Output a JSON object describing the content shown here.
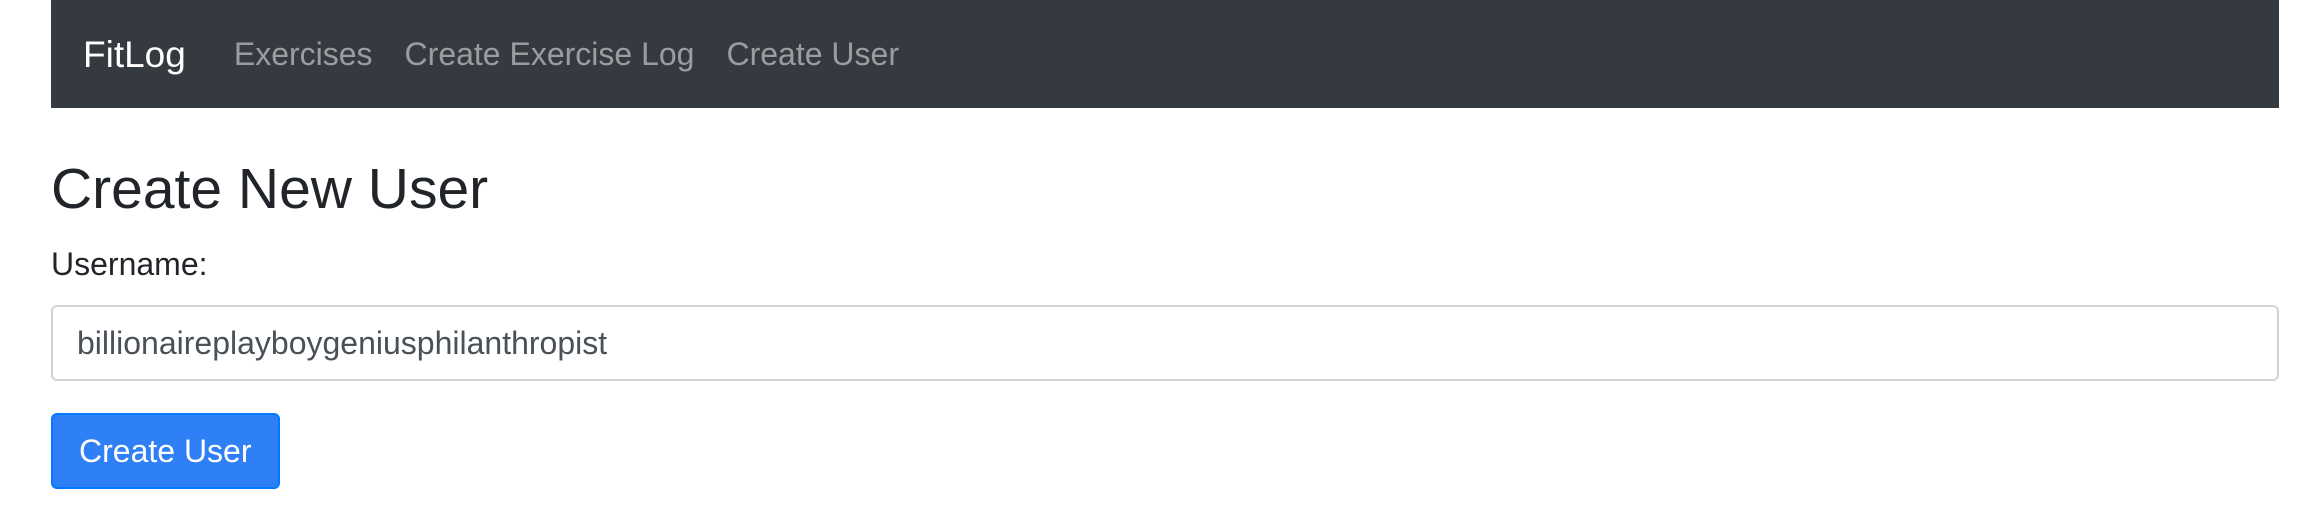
{
  "navbar": {
    "brand": "FitLog",
    "links": [
      {
        "label": "Exercises"
      },
      {
        "label": "Create Exercise Log"
      },
      {
        "label": "Create User"
      }
    ]
  },
  "page": {
    "title": "Create New User"
  },
  "form": {
    "username_label": "Username:",
    "username_value": "billionaireplayboygeniusphilanthropist",
    "submit_label": "Create User"
  },
  "colors": {
    "navbar_bg": "#343a40",
    "primary": "#2f80f6"
  }
}
